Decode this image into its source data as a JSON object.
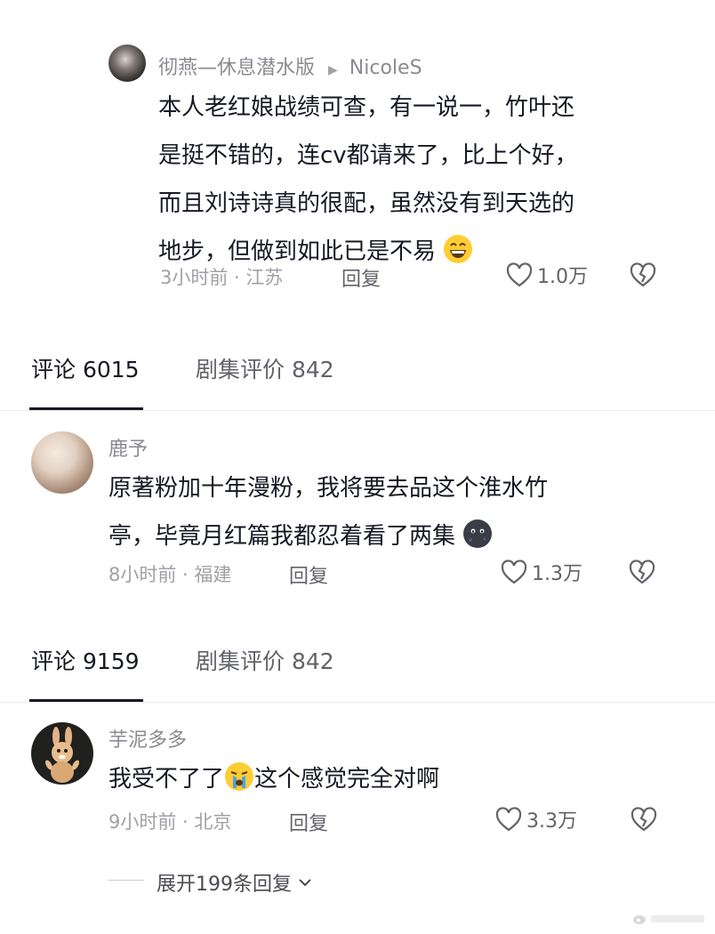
{
  "thread_reply": {
    "author": "彻燕—休息潜水版",
    "reply_to": "NicoleS",
    "lines": [
      "本人老红娘战绩可查，有一说一，竹叶还",
      "是挺不错的，连cv都请来了，比上个好，",
      "而且刘诗诗真的很配，虽然没有到天选的",
      "地步，但做到如此已是不易"
    ],
    "emoji": "grinning-face-emoji",
    "meta": "3小时前 · 江苏",
    "reply_label": "回复",
    "likes": "1.0万"
  },
  "tabs_1": {
    "comments": "评论 6015",
    "reviews": "剧集评价 842"
  },
  "comment_1": {
    "author": "鹿予",
    "lines": [
      "原著粉加十年漫粉，我将要去品这个淮水竹",
      "亭，毕竟月红篇我都忍着看了两集"
    ],
    "emoji": "dark-moon-face-emoji",
    "meta": "8小时前 · 福建",
    "reply_label": "回复",
    "likes": "1.3万"
  },
  "tabs_2": {
    "comments": "评论 9159",
    "reviews": "剧集评价 842"
  },
  "comment_2": {
    "author": "芋泥多多",
    "text_before": "我受不了了",
    "emoji": "crying-face-emoji",
    "text_after": "这个感觉完全对啊",
    "meta": "9小时前 · 北京",
    "reply_label": "回复",
    "likes": "3.3万",
    "expand_label": "展开199条回复"
  },
  "colors": {
    "text": "#161823",
    "muted": "#a0a1a6",
    "accent": "#161823"
  }
}
